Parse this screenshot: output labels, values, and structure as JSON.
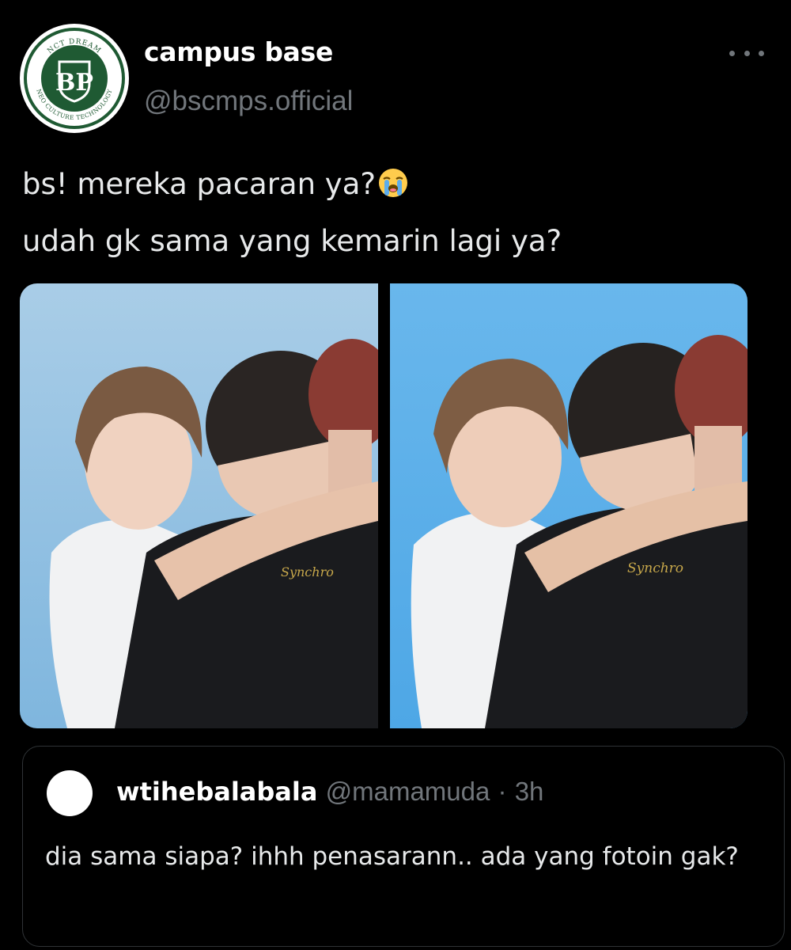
{
  "tweet": {
    "display_name": "campus base",
    "handle": "@bscmps.official",
    "avatar_logo_text": [
      "NCT DREAM",
      "NEO CULTURE TECHNOLOGY",
      "BP"
    ],
    "more_icon": "more-horizontal-icon",
    "text_line_1": "bs! mereka pacaran ya?",
    "text_line_1_emoji": "loudly-crying-face",
    "text_line_2": "udah gk sama yang kemarin lagi ya?"
  },
  "media": {
    "count": 2
  },
  "quote": {
    "display_name": "wtihebalabala",
    "handle": "@mamamuda",
    "separator": "·",
    "time": "3h",
    "text": "dia sama siapa? ihhh penasarann.. ada yang fotoin gak?"
  },
  "colors": {
    "background": "#000000",
    "text_primary": "#e7e9ea",
    "text_secondary": "#71767b",
    "border": "#2f3336",
    "logo_green": "#1f5a33"
  }
}
